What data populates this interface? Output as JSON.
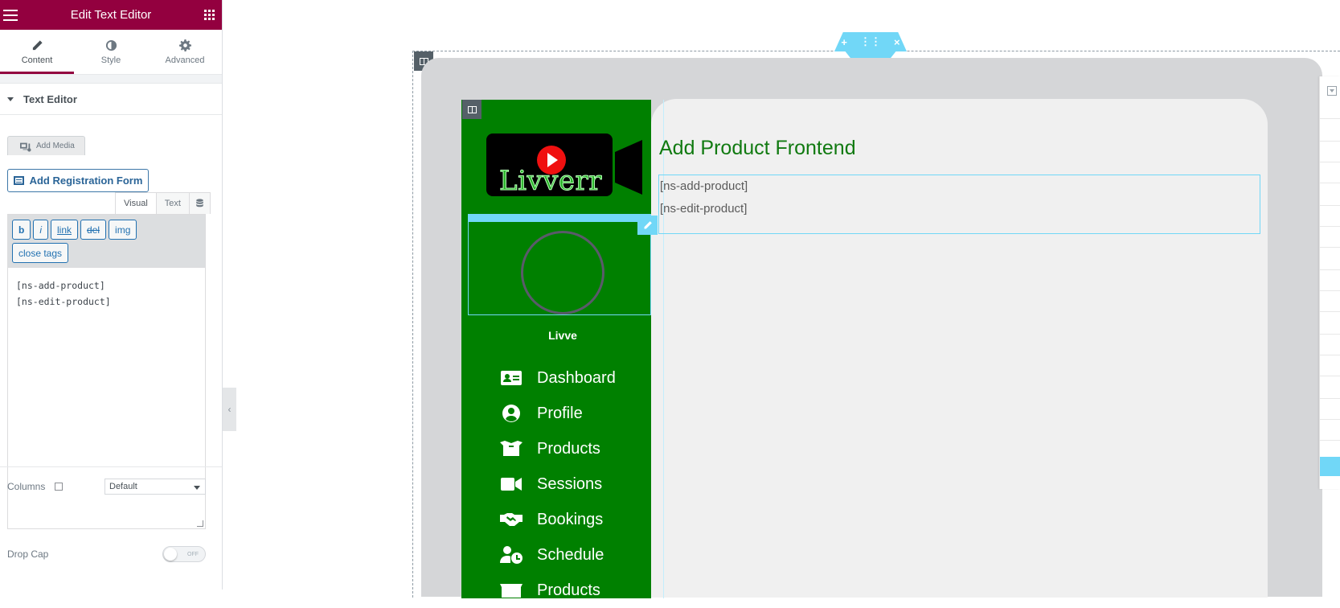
{
  "panel": {
    "title": "Edit Text Editor",
    "tabs": [
      {
        "label": "Content",
        "icon": "pencil-icon"
      },
      {
        "label": "Style",
        "icon": "contrast-icon"
      },
      {
        "label": "Advanced",
        "icon": "gear-icon"
      }
    ],
    "section_title": "Text Editor",
    "add_media_label": "Add Media",
    "add_registration_label": "Add Registration Form",
    "editor_tabs": {
      "visual": "Visual",
      "text": "Text"
    },
    "quicktags": [
      "b",
      "i",
      "link",
      "del",
      "img",
      "close tags"
    ],
    "content_lines": [
      "[ns-add-product]",
      "[ns-edit-product]"
    ],
    "drop_cap_label": "Drop Cap",
    "drop_cap_state": "OFF",
    "columns_label": "Columns",
    "columns_value": "Default"
  },
  "preview": {
    "brand_text": "Livverr",
    "user_name": "Livve",
    "menu": [
      {
        "label": "Dashboard",
        "icon": "id-card-icon"
      },
      {
        "label": "Profile",
        "icon": "user-circle-icon"
      },
      {
        "label": "Products",
        "icon": "box-open-icon"
      },
      {
        "label": "Sessions",
        "icon": "video-icon"
      },
      {
        "label": "Bookings",
        "icon": "handshake-icon"
      },
      {
        "label": "Schedule",
        "icon": "user-clock-icon"
      },
      {
        "label": "Products",
        "icon": "box-icon"
      }
    ],
    "content_title": "Add Product Frontend",
    "shortcodes": [
      "[ns-add-product]",
      "[ns-edit-product]"
    ],
    "section_handle": {
      "add": "+",
      "close": "×"
    }
  },
  "colors": {
    "panel_header": "#93003f",
    "sidebar_green": "#008000",
    "title_green": "#117a11",
    "elementor_blue": "#71d7f7"
  }
}
